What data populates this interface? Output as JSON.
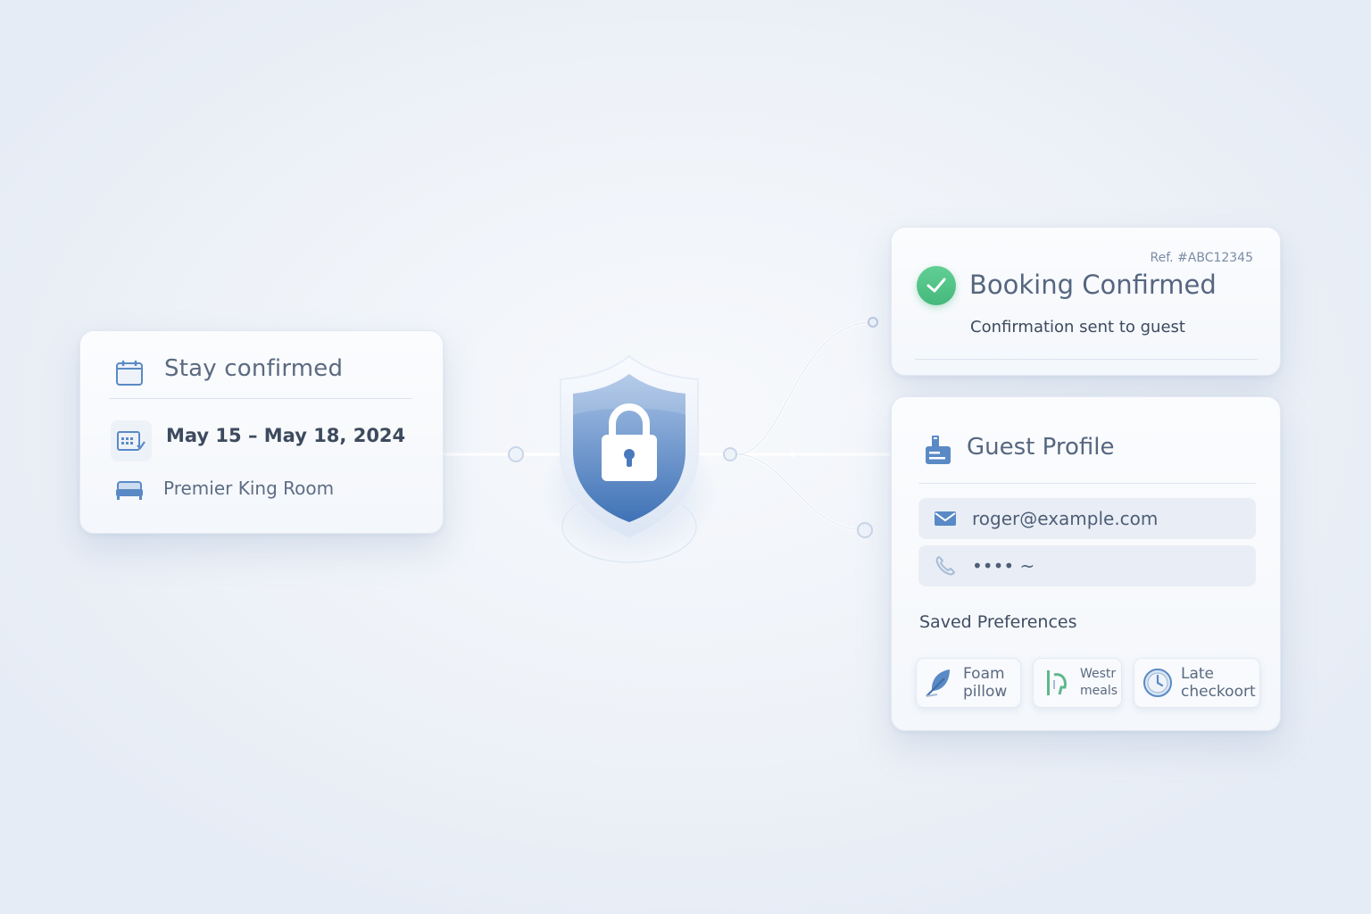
{
  "stay_card": {
    "title": "Stay confirmed",
    "dates": "May 15 – May 18, 2024",
    "room": "Premier King Room"
  },
  "booking_card": {
    "ref": "Ref. #ABC12345",
    "title": "Booking Confirmed",
    "subtitle": "Confirmation sent to guest"
  },
  "profile_card": {
    "title": "Guest Profile",
    "email": "roger@example.com",
    "phone": "•••• ~",
    "prefs_title": "Saved Preferences",
    "prefs": [
      {
        "line1": "Foam",
        "line2": "pillow",
        "icon": "feather-icon"
      },
      {
        "line1": "Westr",
        "line2": "meals",
        "icon": "meal-icon"
      },
      {
        "line1": "Late",
        "line2": "checkoort",
        "icon": "clock-icon"
      }
    ]
  },
  "icons": {
    "stay": "calendar-icon",
    "dates": "calendar-check-icon",
    "room": "bed-icon",
    "security": "shield-lock-icon",
    "booking": "check-icon",
    "profile": "id-card-icon",
    "email": "mail-icon",
    "phone": "phone-icon"
  },
  "colors": {
    "accent": "#4f80c0",
    "success": "#4cbc80",
    "text": "#566680",
    "background": "#eef2f8"
  }
}
